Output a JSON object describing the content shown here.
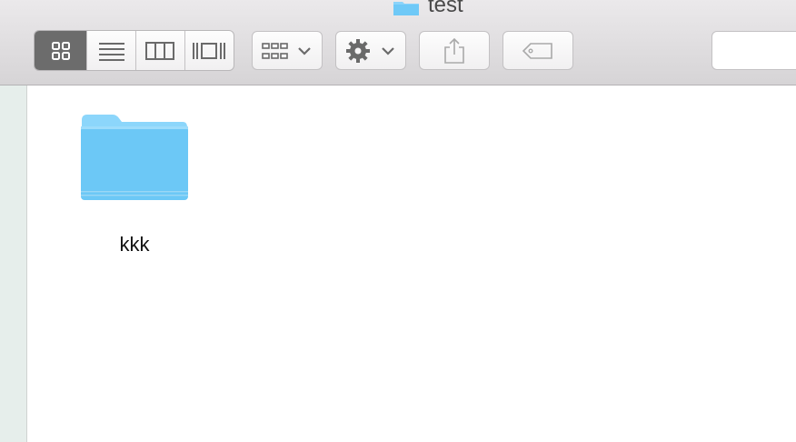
{
  "window": {
    "title": "test"
  },
  "toolbar": {
    "view_modes": [
      "icon-view",
      "list-view",
      "column-view",
      "cover-flow-view"
    ],
    "active_view": "icon-view"
  },
  "content": {
    "items": [
      {
        "name": "kkk",
        "icon": "folder-icon"
      }
    ]
  },
  "colors": {
    "folder": "#6fc9f7",
    "accent_active_segment": "#6c6c6c"
  }
}
